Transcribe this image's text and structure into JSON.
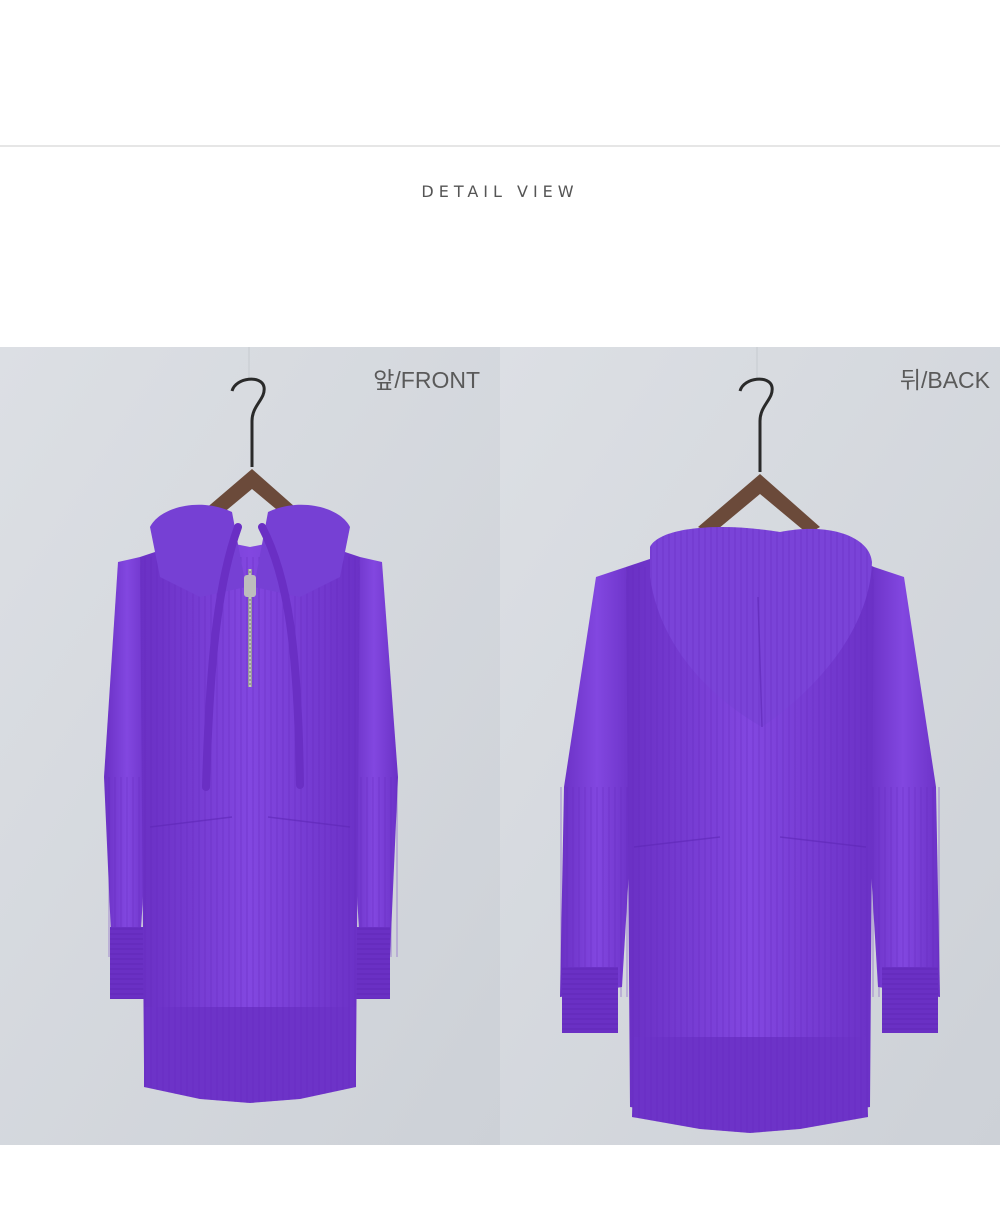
{
  "header": {
    "section_title": "DETAIL VIEW"
  },
  "photos": [
    {
      "id": "front",
      "label": "앞/FRONT",
      "garment_color": "#7a3fd6",
      "background_color": "#d9dde2"
    },
    {
      "id": "back",
      "label": "뒤/BACK",
      "garment_color": "#7a3fd6",
      "background_color": "#d9dde2"
    }
  ],
  "icons": {
    "hanger": "hanger-icon",
    "zipper": "zipper-icon"
  }
}
